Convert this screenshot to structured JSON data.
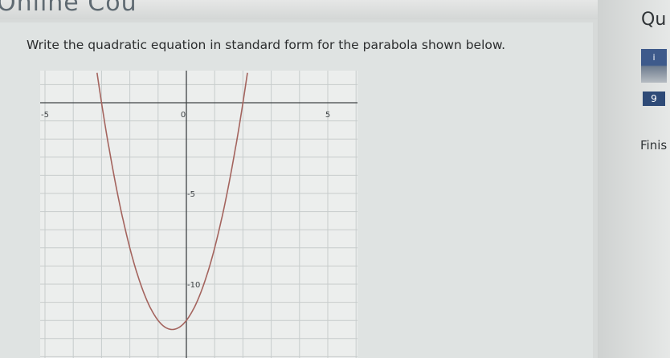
{
  "header": {
    "title_fragment": "Online Cou"
  },
  "question": {
    "text": "Write the quadratic equation in standard form for the parabola shown below."
  },
  "sidebar": {
    "title": "Qu",
    "nav_item_label": "i",
    "badge": "9",
    "finish_label": "Finis"
  },
  "graph": {
    "x_ticks": [
      {
        "value": -5,
        "label": "-5"
      },
      {
        "value": 0,
        "label": "0"
      },
      {
        "value": 5,
        "label": "5"
      }
    ],
    "y_ticks": [
      {
        "value": -5,
        "label": "-5"
      },
      {
        "value": -10,
        "label": "-10"
      }
    ],
    "parabola": {
      "x_intercepts": [
        -3,
        2
      ],
      "vertex": [
        -0.5,
        -12.5
      ],
      "color": "#a4645e"
    },
    "axis_color": "#3f4346",
    "grid_color": "#c7cccc",
    "background": "#eceeed"
  }
}
